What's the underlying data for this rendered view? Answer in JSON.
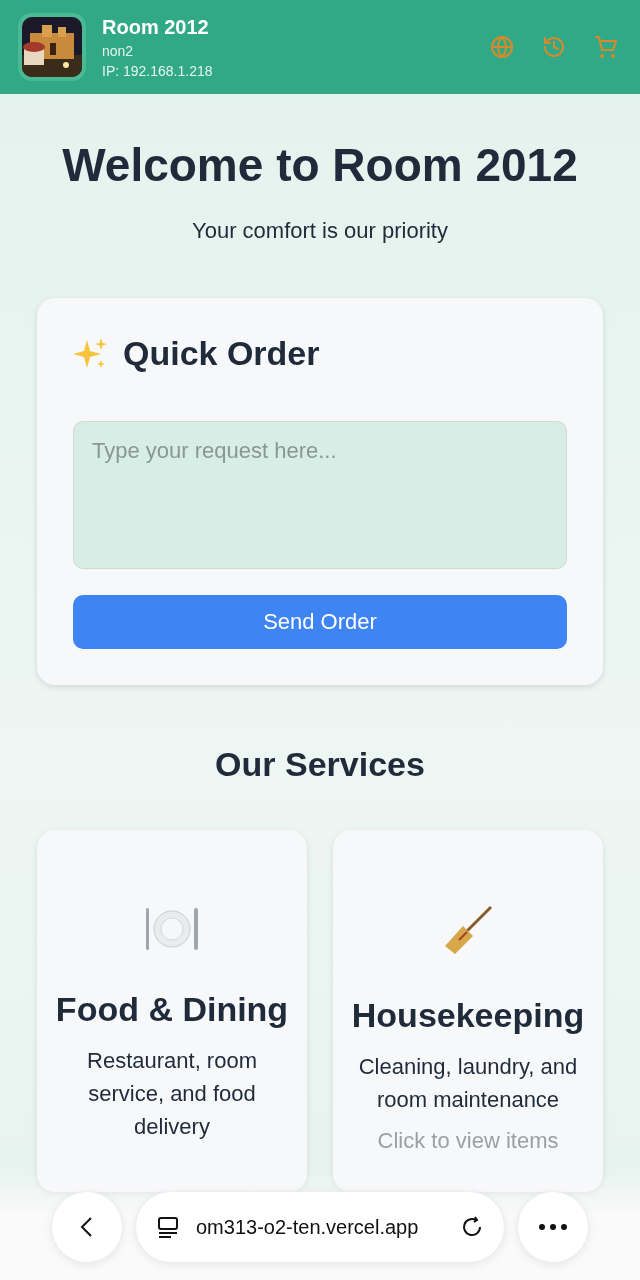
{
  "header": {
    "title": "Room 2012",
    "subtitle": "non2",
    "ip": "IP: 192.168.1.218"
  },
  "welcome": {
    "title": "Welcome to Room 2012",
    "tagline": "Your comfort is our priority"
  },
  "quick_order": {
    "title": "Quick Order",
    "placeholder": "Type your request here...",
    "button": "Send Order"
  },
  "services": {
    "title": "Our Services",
    "items": [
      {
        "kind": "food",
        "title": "Food & Dining",
        "description": "Restaurant, room service, and food delivery"
      },
      {
        "kind": "housekeeping",
        "title": "Housekeeping",
        "description": "Cleaning, laundry, and room maintenance",
        "link": "Click to view items"
      }
    ]
  },
  "browser_bar": {
    "url": "om313-o2-ten.vercel.app"
  }
}
